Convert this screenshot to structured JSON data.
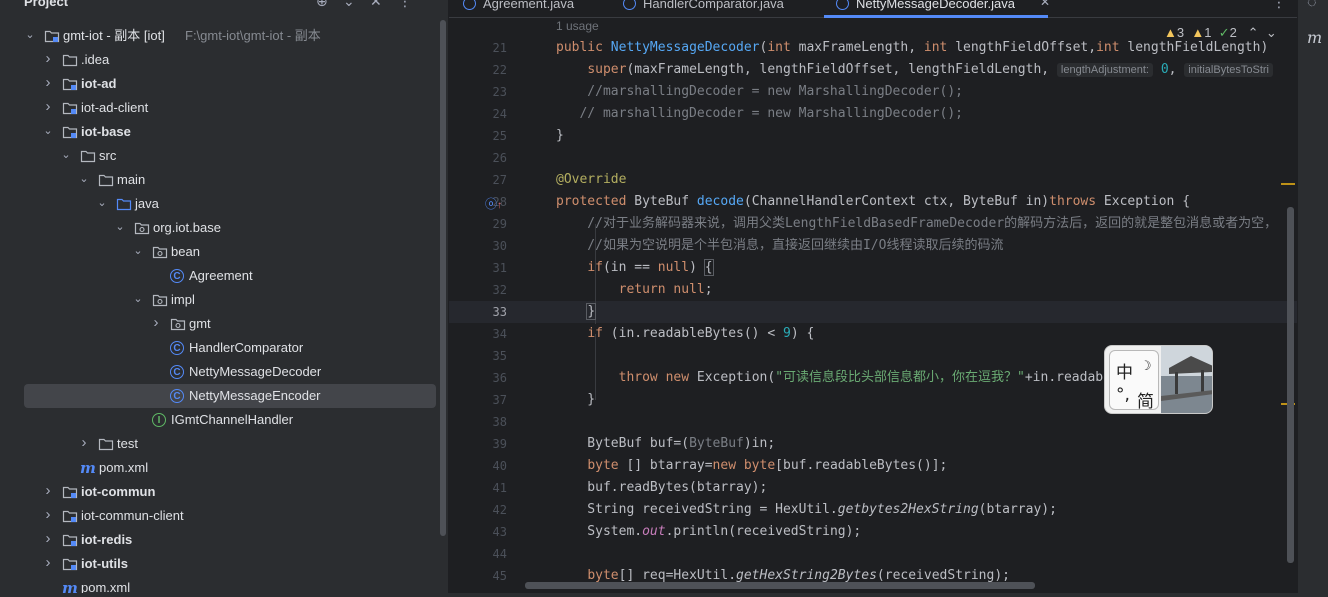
{
  "project": {
    "title": "Project",
    "tree": [
      {
        "label": "gmt-iot - 副本 [iot]",
        "hint": "F:\\gmt-iot\\gmt-iot - 副本",
        "bold": false,
        "icon": "module-folder-icon",
        "chevron": "down"
      },
      {
        "label": ".idea",
        "icon": "folder-icon",
        "chevron": "right"
      },
      {
        "label": "iot-ad",
        "icon": "module-folder-icon",
        "chevron": "right",
        "bold": true
      },
      {
        "label": "iot-ad-client",
        "icon": "module-folder-icon",
        "chevron": "right"
      },
      {
        "label": "iot-base",
        "icon": "module-folder-icon",
        "chevron": "down",
        "bold": true
      },
      {
        "label": "src",
        "icon": "folder-icon",
        "chevron": "down"
      },
      {
        "label": "main",
        "icon": "folder-icon",
        "chevron": "down"
      },
      {
        "label": "java",
        "icon": "source-folder-icon",
        "chevron": "down"
      },
      {
        "label": "org.iot.base",
        "icon": "package-icon",
        "chevron": "down"
      },
      {
        "label": "bean",
        "icon": "package-icon",
        "chevron": "down"
      },
      {
        "label": "Agreement",
        "icon": "class-icon",
        "chevron": ""
      },
      {
        "label": "impl",
        "icon": "package-icon",
        "chevron": "down"
      },
      {
        "label": "gmt",
        "icon": "package-icon",
        "chevron": "right"
      },
      {
        "label": "HandlerComparator",
        "icon": "class-icon",
        "chevron": ""
      },
      {
        "label": "NettyMessageDecoder",
        "icon": "class-icon",
        "chevron": ""
      },
      {
        "label": "NettyMessageEncoder",
        "icon": "class-icon",
        "chevron": "",
        "selected": true
      },
      {
        "label": "IGmtChannelHandler",
        "icon": "interface-icon",
        "chevron": ""
      },
      {
        "label": "test",
        "icon": "folder-icon",
        "chevron": "right"
      },
      {
        "label": "pom.xml",
        "icon": "maven-icon",
        "chevron": ""
      },
      {
        "label": "iot-commun",
        "icon": "module-folder-icon",
        "chevron": "right",
        "bold": true
      },
      {
        "label": "iot-commun-client",
        "icon": "module-folder-icon",
        "chevron": "right"
      },
      {
        "label": "iot-redis",
        "icon": "module-folder-icon",
        "chevron": "right",
        "bold": true
      },
      {
        "label": "iot-utils",
        "icon": "module-folder-icon",
        "chevron": "right",
        "bold": true
      },
      {
        "label": "pom.xml",
        "icon": "maven-icon",
        "chevron": ""
      }
    ]
  },
  "tabs": [
    {
      "label": "Agreement.java",
      "active": false
    },
    {
      "label": "HandlerComparator.java",
      "active": false
    },
    {
      "label": "NettyMessageDecoder.java",
      "active": true
    }
  ],
  "editor": {
    "usage": "1 usage",
    "inspections": {
      "warnings": "3",
      "weak_warnings": "1",
      "ok": "2"
    },
    "current_line": "33",
    "line_numbers": [
      "21",
      "22",
      "23",
      "24",
      "25",
      "26",
      "27",
      "28",
      "29",
      "30",
      "31",
      "32",
      "33",
      "34",
      "35",
      "36",
      "37",
      "38",
      "39",
      "40",
      "41",
      "42",
      "43",
      "44",
      "45"
    ]
  },
  "ime": {
    "mode": "中",
    "punct": "°,",
    "script": "简"
  },
  "colors": {
    "accent": "#548af7",
    "background": "#1e1f22",
    "panel": "#2b2d30"
  }
}
